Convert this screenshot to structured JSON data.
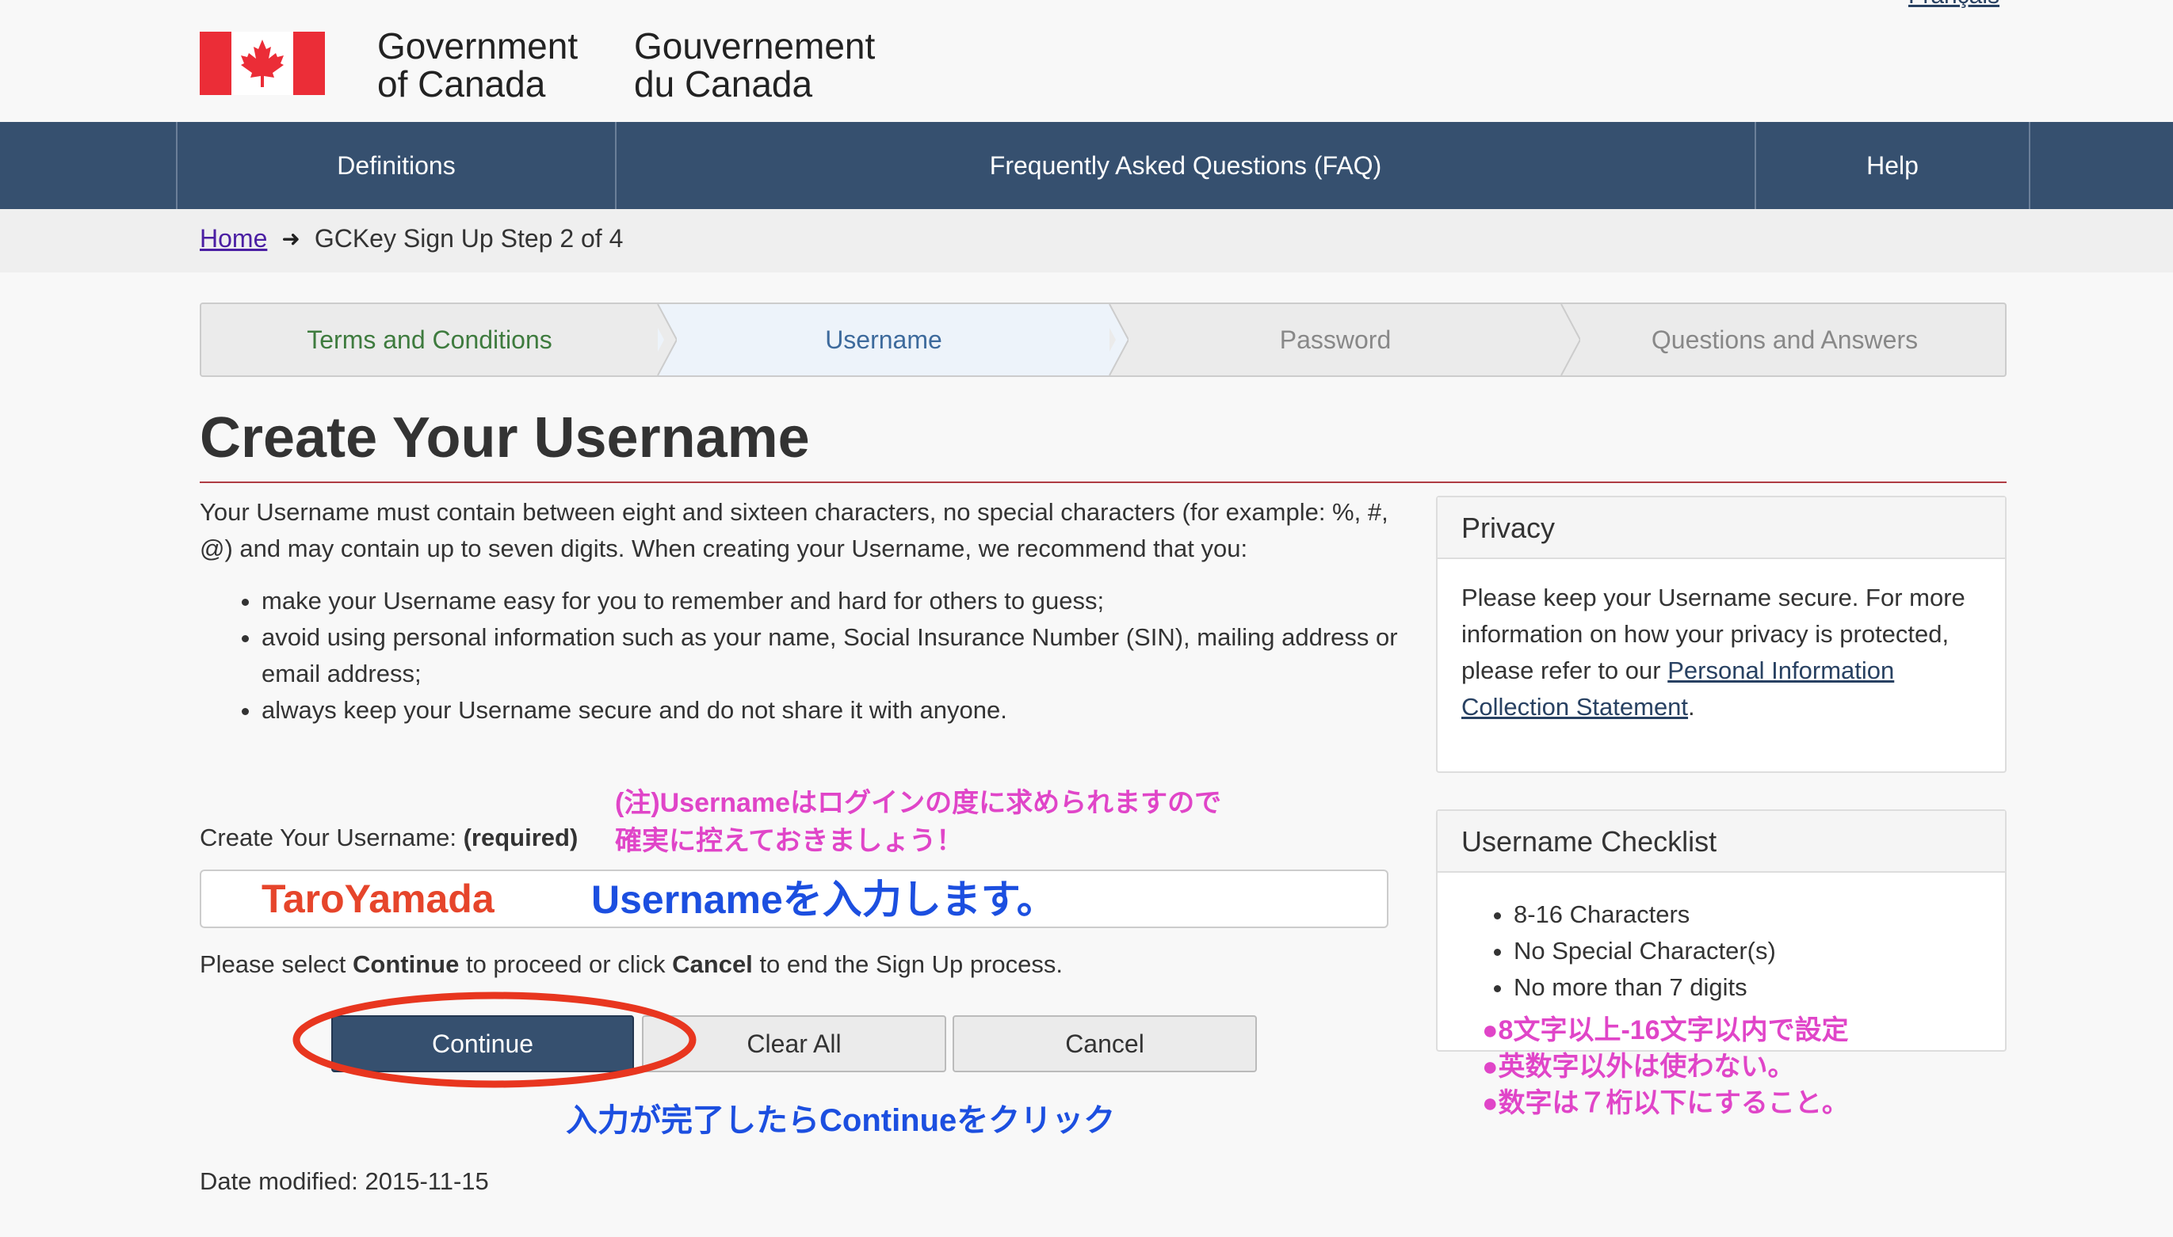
{
  "header": {
    "lang_link": "Français",
    "wordmark_en_line1": "Government",
    "wordmark_en_line2": "of Canada",
    "wordmark_fr_line1": "Gouvernement",
    "wordmark_fr_line2": "du Canada"
  },
  "nav": {
    "definitions": "Definitions",
    "faq": "Frequently Asked Questions (FAQ)",
    "help": "Help"
  },
  "breadcrumb": {
    "home": "Home",
    "current": "GCKey Sign Up Step 2 of 4"
  },
  "steps": [
    {
      "label": "Terms and Conditions",
      "state": "complete"
    },
    {
      "label": "Username",
      "state": "current"
    },
    {
      "label": "Password",
      "state": "pending"
    },
    {
      "label": "Questions and Answers",
      "state": "pending"
    }
  ],
  "page": {
    "title": "Create Your Username",
    "intro": "Your Username must contain between eight and sixteen characters, no special characters (for example: %, #, @) and may contain up to seven digits. When creating your Username, we recommend that you:",
    "rules": [
      "make your Username easy for you to remember and hard for others to guess;",
      "avoid using personal information such as your name, Social Insurance Number (SIN), mailing address or email address;",
      "always keep your Username secure and do not share it with anyone."
    ],
    "date_modified": "Date modified: 2015-11-15"
  },
  "form": {
    "label": "Create Your Username:",
    "required": "(required)",
    "username_value": "TaroYamada",
    "instr_pre": "Please select",
    "instr_continue": "Continue",
    "instr_mid": "to proceed or click",
    "instr_cancel": "Cancel",
    "instr_post": "to end the Sign Up process.",
    "continue": "Continue",
    "clear": "Clear All",
    "cancel": "Cancel"
  },
  "privacy": {
    "heading": "Privacy",
    "body": "Please keep your Username secure. For more information on how your privacy is protected, please refer to our",
    "link": "Personal Information Collection Statement",
    "tail": "."
  },
  "checklist": {
    "heading": "Username Checklist",
    "items": [
      "8-16 Characters",
      "No Special Character(s)",
      "No more than 7 digits"
    ]
  },
  "annotations": {
    "note_line1": "(注)Usernameはログインの度に求められますので",
    "note_line2": "確実に控えておきましょう！",
    "input_hint": "Usernameを入力します。",
    "continue_hint": "入力が完了したらContinueをクリック",
    "rule1": "●8文字以上-16文字以内で設定",
    "rule2": "●英数字以外は使わない。",
    "rule3": "●数字は７桁以下にすること。"
  },
  "colors": {
    "nav_bg": "#36506f",
    "title_rule": "#af3c43",
    "annotation_pink": "#e045c8",
    "annotation_blue": "#1c4fe0",
    "annotation_red": "#e6452b"
  }
}
